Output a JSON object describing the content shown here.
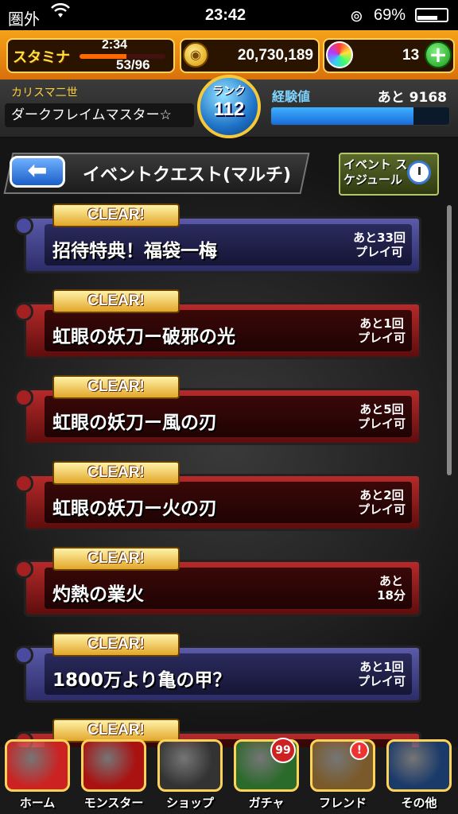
{
  "status_bar": {
    "carrier": "圏外",
    "time": "23:42",
    "battery": "69%",
    "battery_fraction": 0.69
  },
  "hud": {
    "stamina_label": "スタミナ",
    "stamina_timer": "2:34",
    "stamina_count": "53/96",
    "stamina_fraction": 0.55,
    "coins": "20,730,189",
    "orbs": "13",
    "plus": "+"
  },
  "profile": {
    "title": "カリスマ二世",
    "name": "ダークフレイムマスター☆",
    "rank_label": "ランク",
    "rank": "112",
    "exp_label": "経験値",
    "exp_remaining": "あと 9168",
    "exp_fraction": 0.8
  },
  "header": {
    "back": "⬅",
    "title": "イベントクエスト(マルチ)",
    "schedule": "イベント スケジュール"
  },
  "quests": [
    {
      "tag": "CLEAR!",
      "name": "招待特典！福袋一梅",
      "plays": "あと33回\nプレイ可",
      "color": "blue"
    },
    {
      "tag": "CLEAR!",
      "name": "虹眼の妖刀ー破邪の光",
      "plays": "あと1回\nプレイ可",
      "color": "red"
    },
    {
      "tag": "CLEAR!",
      "name": "虹眼の妖刀ー風の刃",
      "plays": "あと5回\nプレイ可",
      "color": "red"
    },
    {
      "tag": "CLEAR!",
      "name": "虹眼の妖刀ー火の刃",
      "plays": "あと2回\nプレイ可",
      "color": "red"
    },
    {
      "tag": "CLEAR!",
      "name": "灼熱の業火",
      "plays": "あと\n18分",
      "color": "red"
    },
    {
      "tag": "CLEAR!",
      "name": "1800万より亀の甲？",
      "plays": "あと1回\nプレイ可",
      "color": "blue"
    },
    {
      "tag": "CLEAR!",
      "name": "",
      "plays": "",
      "color": "red"
    }
  ],
  "tabs": [
    {
      "label": "ホーム",
      "icon": "home-dragon-icon",
      "color": "#c22"
    },
    {
      "label": "モンスター",
      "icon": "monster-icon",
      "color": "#a11"
    },
    {
      "label": "ショップ",
      "icon": "rainbow-orb-icon",
      "color": "#333"
    },
    {
      "label": "ガチャ",
      "icon": "egg-icon",
      "color": "#2a6a2a",
      "badge": "99"
    },
    {
      "label": "フレンド",
      "icon": "handshake-icon",
      "color": "#7a5a2a",
      "badge": "!"
    },
    {
      "label": "その他",
      "icon": "radar-icon",
      "color": "#1a3a6a"
    }
  ]
}
